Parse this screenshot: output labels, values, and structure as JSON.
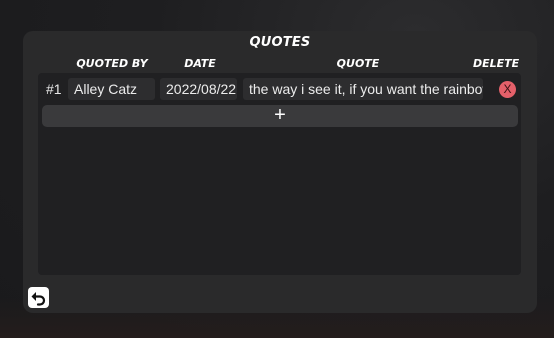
{
  "title": "QUOTES",
  "columns": {
    "quoted_by": "QUOTED BY",
    "date": "DATE",
    "quote": "QUOTE",
    "delete": "DELETE"
  },
  "rows": [
    {
      "index": "#1",
      "quoted_by": "Alley Catz",
      "date": "2022/08/22",
      "quote": "the way i see it, if you want the rainbow,",
      "delete_label": "X"
    }
  ],
  "add_label": "+",
  "icons": {
    "delete": "close-icon",
    "add": "plus-icon",
    "back": "undo-arrow-icon"
  },
  "colors": {
    "delete": "#e4606a"
  }
}
